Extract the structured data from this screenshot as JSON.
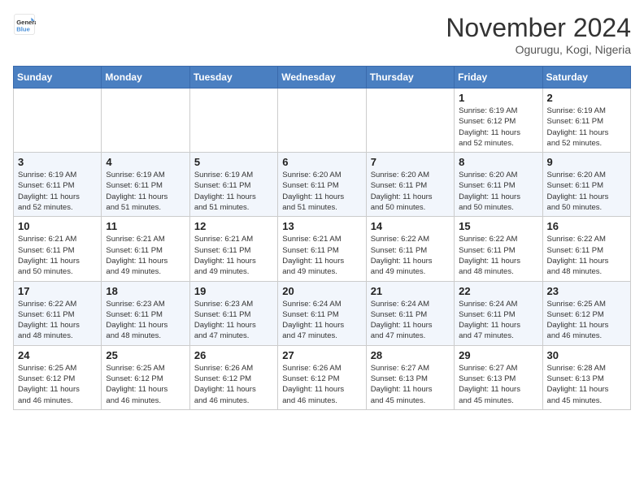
{
  "logo": {
    "general": "General",
    "blue": "Blue"
  },
  "title": "November 2024",
  "location": "Ogurugu, Kogi, Nigeria",
  "weekdays": [
    "Sunday",
    "Monday",
    "Tuesday",
    "Wednesday",
    "Thursday",
    "Friday",
    "Saturday"
  ],
  "weeks": [
    [
      {
        "day": "",
        "info": ""
      },
      {
        "day": "",
        "info": ""
      },
      {
        "day": "",
        "info": ""
      },
      {
        "day": "",
        "info": ""
      },
      {
        "day": "",
        "info": ""
      },
      {
        "day": "1",
        "info": "Sunrise: 6:19 AM\nSunset: 6:12 PM\nDaylight: 11 hours\nand 52 minutes."
      },
      {
        "day": "2",
        "info": "Sunrise: 6:19 AM\nSunset: 6:11 PM\nDaylight: 11 hours\nand 52 minutes."
      }
    ],
    [
      {
        "day": "3",
        "info": "Sunrise: 6:19 AM\nSunset: 6:11 PM\nDaylight: 11 hours\nand 52 minutes."
      },
      {
        "day": "4",
        "info": "Sunrise: 6:19 AM\nSunset: 6:11 PM\nDaylight: 11 hours\nand 51 minutes."
      },
      {
        "day": "5",
        "info": "Sunrise: 6:19 AM\nSunset: 6:11 PM\nDaylight: 11 hours\nand 51 minutes."
      },
      {
        "day": "6",
        "info": "Sunrise: 6:20 AM\nSunset: 6:11 PM\nDaylight: 11 hours\nand 51 minutes."
      },
      {
        "day": "7",
        "info": "Sunrise: 6:20 AM\nSunset: 6:11 PM\nDaylight: 11 hours\nand 50 minutes."
      },
      {
        "day": "8",
        "info": "Sunrise: 6:20 AM\nSunset: 6:11 PM\nDaylight: 11 hours\nand 50 minutes."
      },
      {
        "day": "9",
        "info": "Sunrise: 6:20 AM\nSunset: 6:11 PM\nDaylight: 11 hours\nand 50 minutes."
      }
    ],
    [
      {
        "day": "10",
        "info": "Sunrise: 6:21 AM\nSunset: 6:11 PM\nDaylight: 11 hours\nand 50 minutes."
      },
      {
        "day": "11",
        "info": "Sunrise: 6:21 AM\nSunset: 6:11 PM\nDaylight: 11 hours\nand 49 minutes."
      },
      {
        "day": "12",
        "info": "Sunrise: 6:21 AM\nSunset: 6:11 PM\nDaylight: 11 hours\nand 49 minutes."
      },
      {
        "day": "13",
        "info": "Sunrise: 6:21 AM\nSunset: 6:11 PM\nDaylight: 11 hours\nand 49 minutes."
      },
      {
        "day": "14",
        "info": "Sunrise: 6:22 AM\nSunset: 6:11 PM\nDaylight: 11 hours\nand 49 minutes."
      },
      {
        "day": "15",
        "info": "Sunrise: 6:22 AM\nSunset: 6:11 PM\nDaylight: 11 hours\nand 48 minutes."
      },
      {
        "day": "16",
        "info": "Sunrise: 6:22 AM\nSunset: 6:11 PM\nDaylight: 11 hours\nand 48 minutes."
      }
    ],
    [
      {
        "day": "17",
        "info": "Sunrise: 6:22 AM\nSunset: 6:11 PM\nDaylight: 11 hours\nand 48 minutes."
      },
      {
        "day": "18",
        "info": "Sunrise: 6:23 AM\nSunset: 6:11 PM\nDaylight: 11 hours\nand 48 minutes."
      },
      {
        "day": "19",
        "info": "Sunrise: 6:23 AM\nSunset: 6:11 PM\nDaylight: 11 hours\nand 47 minutes."
      },
      {
        "day": "20",
        "info": "Sunrise: 6:24 AM\nSunset: 6:11 PM\nDaylight: 11 hours\nand 47 minutes."
      },
      {
        "day": "21",
        "info": "Sunrise: 6:24 AM\nSunset: 6:11 PM\nDaylight: 11 hours\nand 47 minutes."
      },
      {
        "day": "22",
        "info": "Sunrise: 6:24 AM\nSunset: 6:11 PM\nDaylight: 11 hours\nand 47 minutes."
      },
      {
        "day": "23",
        "info": "Sunrise: 6:25 AM\nSunset: 6:12 PM\nDaylight: 11 hours\nand 46 minutes."
      }
    ],
    [
      {
        "day": "24",
        "info": "Sunrise: 6:25 AM\nSunset: 6:12 PM\nDaylight: 11 hours\nand 46 minutes."
      },
      {
        "day": "25",
        "info": "Sunrise: 6:25 AM\nSunset: 6:12 PM\nDaylight: 11 hours\nand 46 minutes."
      },
      {
        "day": "26",
        "info": "Sunrise: 6:26 AM\nSunset: 6:12 PM\nDaylight: 11 hours\nand 46 minutes."
      },
      {
        "day": "27",
        "info": "Sunrise: 6:26 AM\nSunset: 6:12 PM\nDaylight: 11 hours\nand 46 minutes."
      },
      {
        "day": "28",
        "info": "Sunrise: 6:27 AM\nSunset: 6:13 PM\nDaylight: 11 hours\nand 45 minutes."
      },
      {
        "day": "29",
        "info": "Sunrise: 6:27 AM\nSunset: 6:13 PM\nDaylight: 11 hours\nand 45 minutes."
      },
      {
        "day": "30",
        "info": "Sunrise: 6:28 AM\nSunset: 6:13 PM\nDaylight: 11 hours\nand 45 minutes."
      }
    ]
  ]
}
